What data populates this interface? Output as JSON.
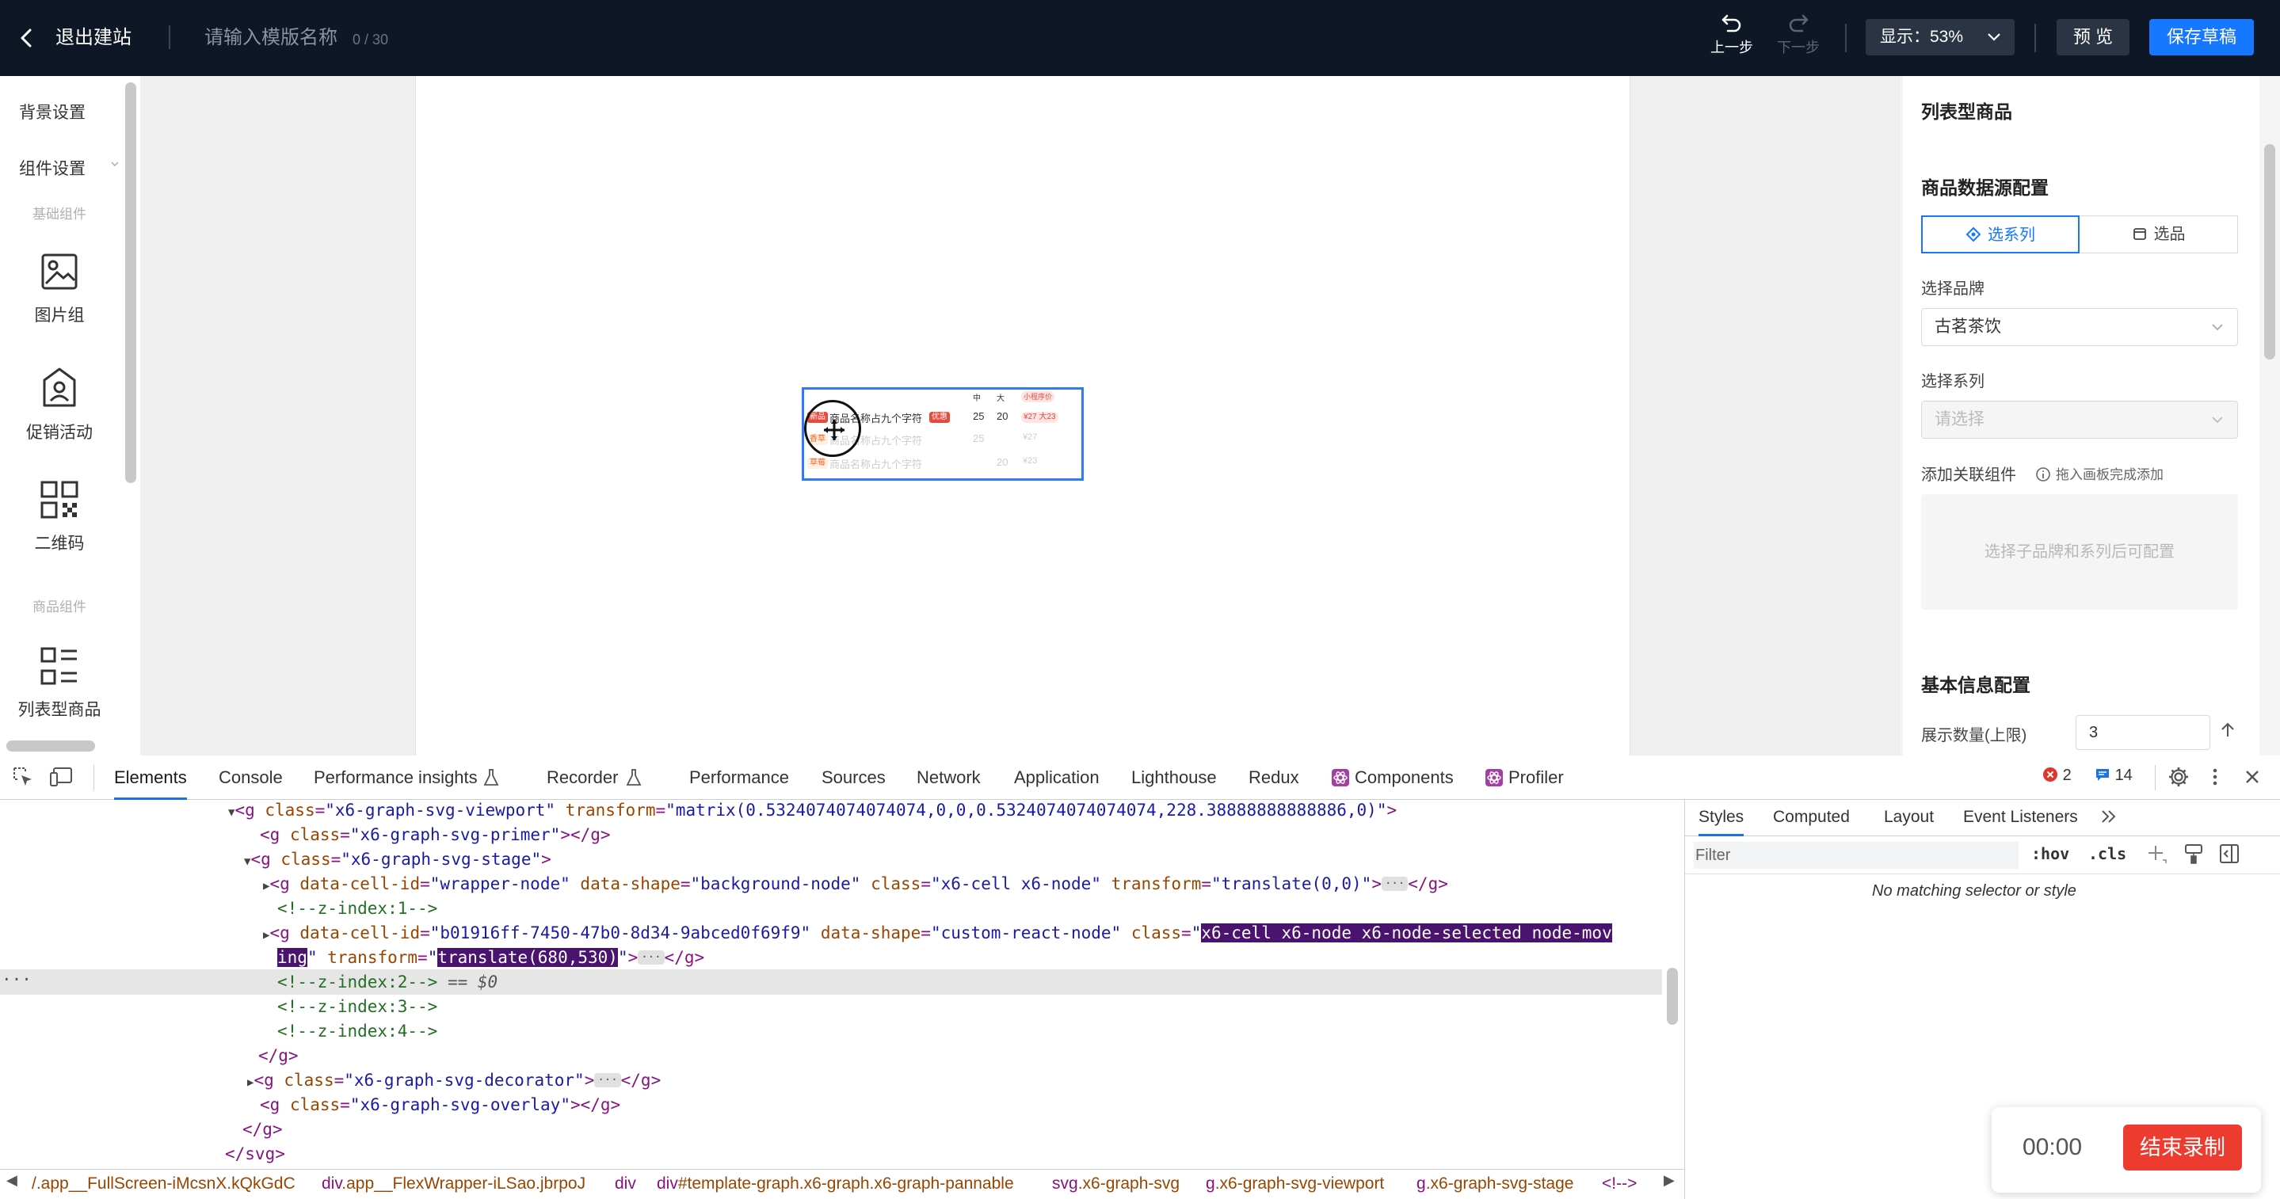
{
  "topbar": {
    "exit_label": "退出建站",
    "template_placeholder": "请输入模版名称",
    "template_count": "0 / 30",
    "undo_label": "上一步",
    "redo_label": "下一步",
    "zoom_label": "显示：53%",
    "preview_label": "预 览",
    "save_label": "保存草稿"
  },
  "left_panel": {
    "background_settings": "背景设置",
    "component_settings": "组件设置",
    "group_basic": "基础组件",
    "group_product": "商品组件",
    "components": [
      {
        "label": "图片组",
        "icon": "image-icon"
      },
      {
        "label": "促销活动",
        "icon": "promo-icon"
      },
      {
        "label": "二维码",
        "icon": "qrcode-icon"
      },
      {
        "label": "列表型商品",
        "icon": "list-icon"
      }
    ]
  },
  "canvas_node": {
    "headers": [
      "中",
      "大",
      "小程序价"
    ],
    "rows": [
      {
        "tag": "新品",
        "name": "商品名称占九个字符",
        "badge": "优惠",
        "p1": "25",
        "p2": "20",
        "promo": "¥27 大23"
      },
      {
        "tag": "香草",
        "name": "商品名称占九个字符",
        "badge": "",
        "p1": "25",
        "p2": "",
        "promo": "¥27"
      },
      {
        "tag": "草莓",
        "name": "商品名称占九个字符",
        "badge": "",
        "p1": "",
        "p2": "20",
        "promo": "¥23"
      }
    ]
  },
  "right_panel": {
    "title": "列表型商品",
    "datasource_title": "商品数据源配置",
    "seg_series": "选系列",
    "seg_product": "选品",
    "brand_label": "选择品牌",
    "brand_value": "古茗茶饮",
    "series_label": "选择系列",
    "series_placeholder": "请选择",
    "related_label": "添加关联组件",
    "related_hint": "拖入画板完成添加",
    "drop_area_text": "选择子品牌和系列后可配置",
    "basic_title": "基本信息配置",
    "display_count_label": "展示数量(上限)",
    "display_count_value": "3"
  },
  "devtools": {
    "tabs": [
      "Elements",
      "Console",
      "Performance insights",
      "Recorder",
      "Performance",
      "Sources",
      "Network",
      "Application",
      "Lighthouse",
      "Redux",
      "Components",
      "Profiler"
    ],
    "error_count": "2",
    "message_count": "14",
    "styles_tabs": [
      "Styles",
      "Computed",
      "Layout",
      "Event Listeners"
    ],
    "filter_placeholder": "Filter",
    "hov": ":hov",
    "cls": ".cls",
    "no_match": "No matching selector or style",
    "breadcrumbs": [
      {
        "tag": "",
        "cls": "/.app__FullScreen-iMcsnX.kQkGdC"
      },
      {
        "tag": "div",
        "cls": ".app__FlexWrapper-iLSao.jbrpoJ"
      },
      {
        "tag": "div",
        "cls": ""
      },
      {
        "tag": "div",
        "cls": "#template-graph.x6-graph.x6-graph-pannable"
      },
      {
        "tag": "svg",
        "cls": ".x6-graph-svg"
      },
      {
        "tag": "g",
        "cls": ".x6-graph-svg-viewport"
      },
      {
        "tag": "g",
        "cls": ".x6-graph-svg-stage"
      },
      {
        "tag": "<!--",
        "cls": ">"
      }
    ]
  },
  "recording": {
    "time": "00:00",
    "stop_label": "结束录制"
  }
}
